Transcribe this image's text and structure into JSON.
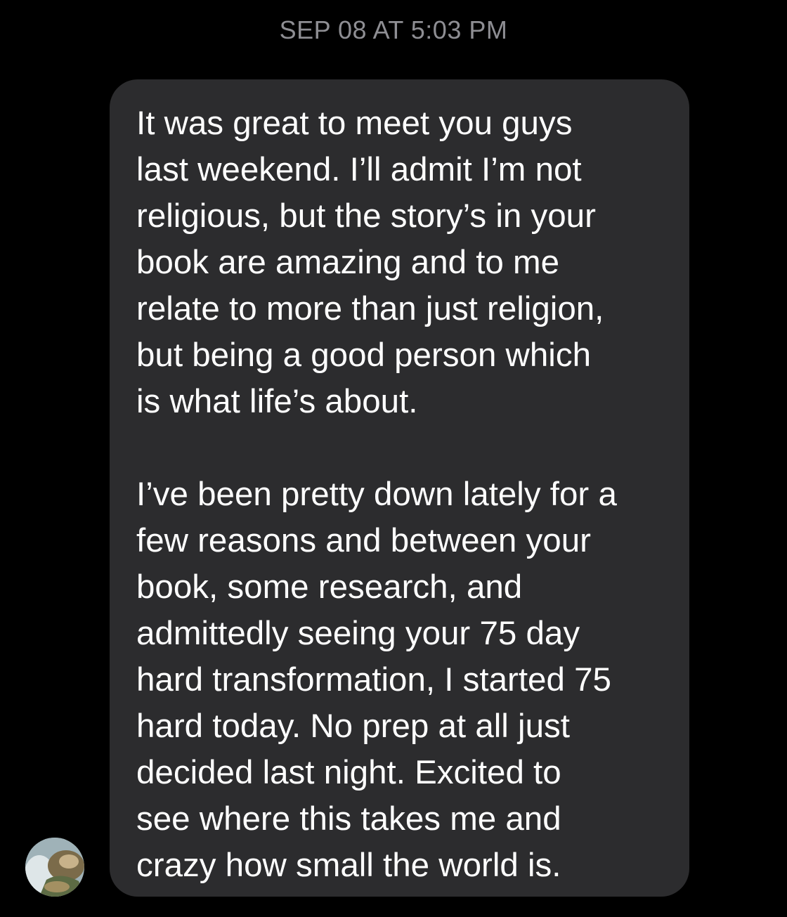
{
  "thread": {
    "timestamp": "SEP 08 AT 5:03 PM"
  },
  "message": {
    "paragraphs": [
      {
        "lines": [
          "It was great to meet you guys",
          "last weekend. I’ll admit I’m not",
          "religious, but the story’s in your",
          "book are amazing and to me",
          "relate to more than just religion,",
          "but being a good person which",
          "is what life’s about."
        ]
      },
      {
        "lines": [
          "I’ve been pretty down lately for a",
          "few reasons and between your",
          "book, some research, and",
          "admittedly seeing your 75 day",
          "hard transformation, I started 75",
          "hard today. No prep at all just",
          "decided last night. Excited to",
          "see where this takes me and",
          "crazy how small the world is."
        ]
      }
    ]
  },
  "colors": {
    "background": "#000000",
    "bubble": "#2c2c2e",
    "text": "#ffffff",
    "timestamp": "#8e8e93"
  }
}
